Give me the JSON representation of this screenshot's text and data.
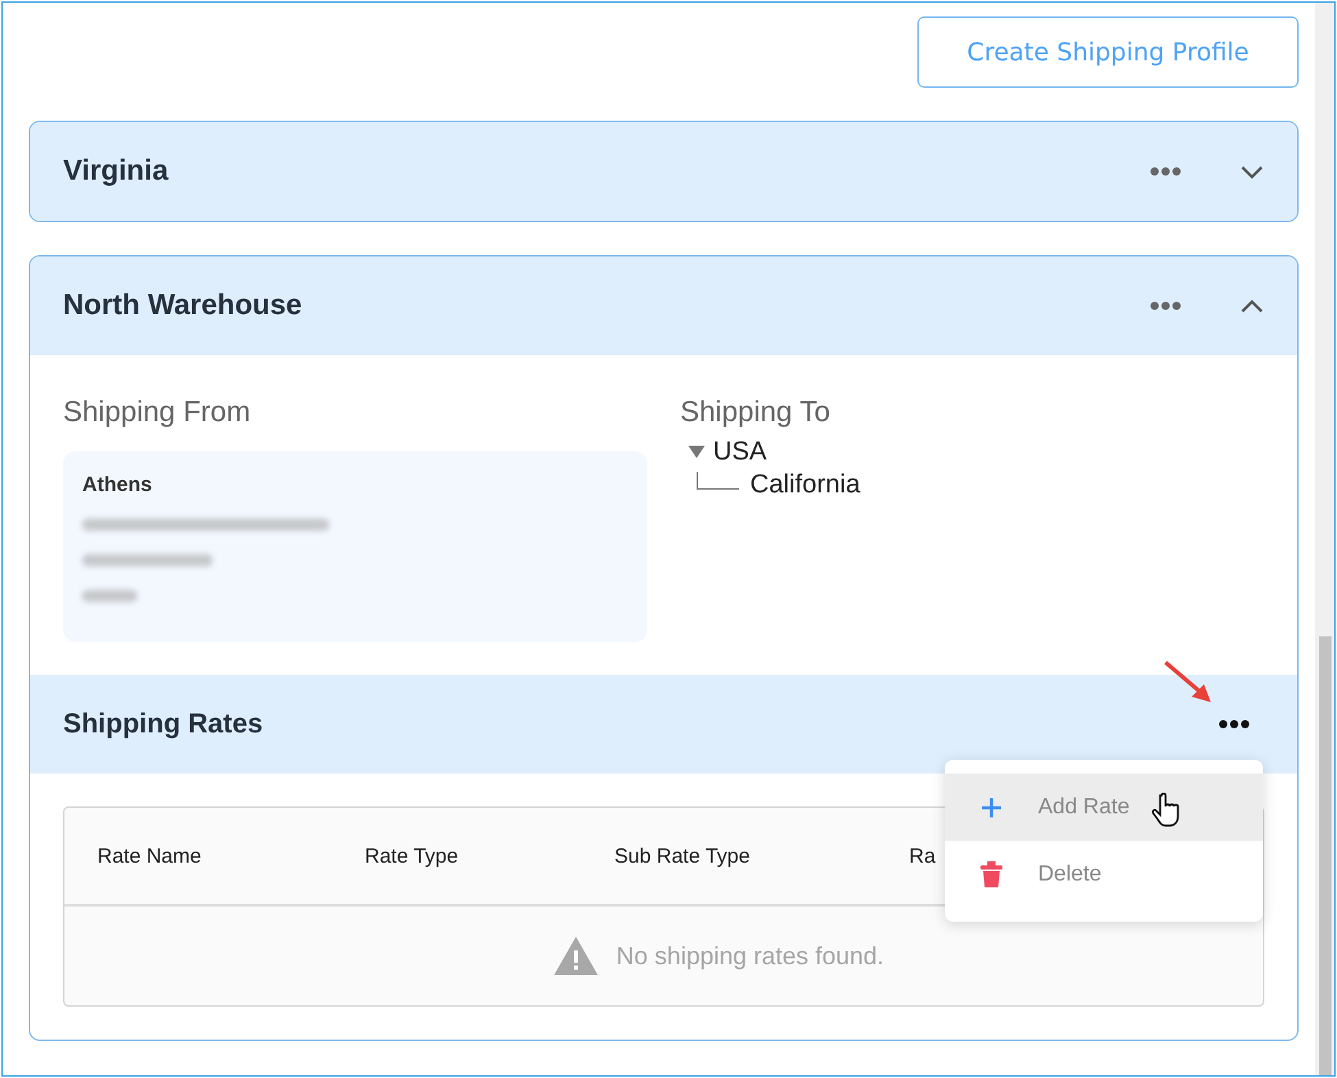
{
  "create_button": "Create Shipping Profile",
  "profiles": [
    {
      "name": "Virginia",
      "expanded": false
    },
    {
      "name": "North Warehouse",
      "expanded": true,
      "shipping_from": {
        "label": "Shipping From",
        "location": "Athens"
      },
      "shipping_to": {
        "label": "Shipping To",
        "tree": [
          {
            "label": "USA",
            "expanded": true,
            "children": [
              {
                "label": "California"
              }
            ]
          }
        ]
      },
      "rates": {
        "title": "Shipping Rates",
        "columns": [
          "Rate Name",
          "Rate Type",
          "Sub Rate Type",
          "Ra"
        ],
        "empty_message": "No shipping rates found.",
        "menu": [
          {
            "kind": "add",
            "label": "Add Rate",
            "selected": true
          },
          {
            "kind": "delete",
            "label": "Delete",
            "selected": false
          }
        ]
      }
    }
  ]
}
